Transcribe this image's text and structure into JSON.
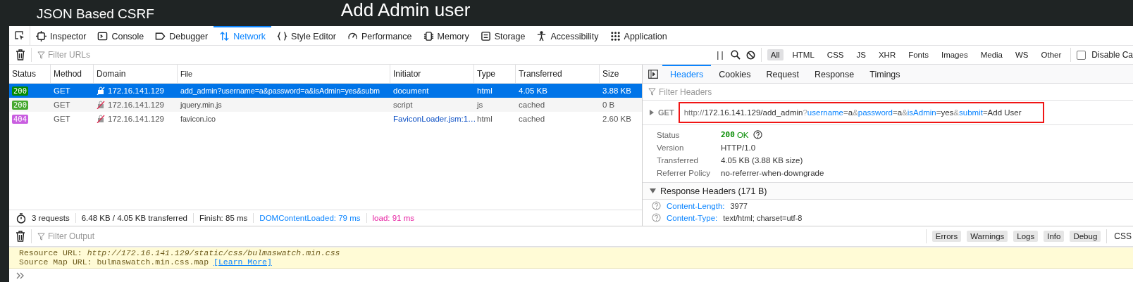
{
  "page": {
    "subtitle": "JSON Based CSRF",
    "heading": "Add Admin user"
  },
  "devtools_tabs": [
    {
      "label": "Inspector",
      "kind": "inspector",
      "selected": false
    },
    {
      "label": "Console",
      "kind": "console",
      "selected": false
    },
    {
      "label": "Debugger",
      "kind": "debugger",
      "selected": false
    },
    {
      "label": "Network",
      "kind": "network",
      "selected": true
    },
    {
      "label": "Style Editor",
      "kind": "style",
      "selected": false
    },
    {
      "label": "Performance",
      "kind": "performance",
      "selected": false
    },
    {
      "label": "Memory",
      "kind": "memory",
      "selected": false
    },
    {
      "label": "Storage",
      "kind": "storage",
      "selected": false
    },
    {
      "label": "Accessibility",
      "kind": "accessibility",
      "selected": false
    },
    {
      "label": "Application",
      "kind": "application",
      "selected": false
    }
  ],
  "toolbar": {
    "filter_placeholder": "Filter URLs",
    "pause_label": "| |",
    "type_filters": [
      {
        "label": "All",
        "selected": true
      },
      {
        "label": "HTML",
        "selected": false
      },
      {
        "label": "CSS",
        "selected": false
      },
      {
        "label": "JS",
        "selected": false
      },
      {
        "label": "XHR",
        "selected": false
      },
      {
        "label": "Fonts",
        "selected": false
      },
      {
        "label": "Images",
        "selected": false
      },
      {
        "label": "Media",
        "selected": false
      },
      {
        "label": "WS",
        "selected": false
      },
      {
        "label": "Other",
        "selected": false
      }
    ],
    "disable_cache": {
      "label": "Disable Ca",
      "checked": false
    }
  },
  "table": {
    "columns": [
      "Status",
      "Method",
      "Domain",
      "File",
      "Initiator",
      "Type",
      "Transferred",
      "Size"
    ],
    "rows": [
      {
        "status": "200",
        "color": "#058b00",
        "method": "GET",
        "domain": "172.16.141.129",
        "file": "add_admin?username=a&password=a&isAdmin=yes&subm",
        "initiator": "document",
        "initiator_link": false,
        "type": "html",
        "transferred": "4.05 KB",
        "size": "3.88 KB",
        "selected": true
      },
      {
        "status": "200",
        "color": "#45a82f",
        "method": "GET",
        "domain": "172.16.141.129",
        "file": "jquery.min.js",
        "initiator": "script",
        "initiator_link": false,
        "type": "js",
        "transferred": "cached",
        "size": "0 B",
        "selected": false
      },
      {
        "status": "404",
        "color": "#c95ee0",
        "method": "GET",
        "domain": "172.16.141.129",
        "file": "favicon.ico",
        "initiator": "FaviconLoader.jsm:1…",
        "initiator_link": true,
        "type": "html",
        "transferred": "cached",
        "size": "2.60 KB",
        "selected": false
      }
    ]
  },
  "summary": {
    "requests": "3 requests",
    "size": "6.48 KB / 4.05 KB transferred",
    "finish": "Finish: 85 ms",
    "dom_loaded": "DOMContentLoaded: 79 ms",
    "load": "load: 91 ms"
  },
  "details": {
    "tabs": [
      {
        "label": "Headers",
        "selected": true
      },
      {
        "label": "Cookies",
        "selected": false
      },
      {
        "label": "Request",
        "selected": false
      },
      {
        "label": "Response",
        "selected": false
      },
      {
        "label": "Timings",
        "selected": false
      }
    ],
    "filter_placeholder": "Filter Headers",
    "request": {
      "method": "GET",
      "highlighted": true,
      "url_parts": [
        {
          "text": "http://",
          "kind": "scheme"
        },
        {
          "text": "172.16.141.129/add_admin",
          "kind": "path"
        },
        {
          "text": "?",
          "kind": "sep"
        },
        {
          "text": "username",
          "kind": "key"
        },
        {
          "text": "=",
          "kind": "sep"
        },
        {
          "text": "a",
          "kind": "value"
        },
        {
          "text": "&",
          "kind": "sep"
        },
        {
          "text": "password",
          "kind": "key"
        },
        {
          "text": "=",
          "kind": "sep"
        },
        {
          "text": "a",
          "kind": "value"
        },
        {
          "text": "&",
          "kind": "sep"
        },
        {
          "text": "isAdmin",
          "kind": "key"
        },
        {
          "text": "=",
          "kind": "sep"
        },
        {
          "text": "yes",
          "kind": "value"
        },
        {
          "text": "&",
          "kind": "sep"
        },
        {
          "text": "submit",
          "kind": "key"
        },
        {
          "text": "=",
          "kind": "sep"
        },
        {
          "text": "Add User",
          "kind": "value"
        }
      ]
    },
    "status": {
      "label": "Status",
      "code": "200",
      "text": "OK"
    },
    "info": [
      {
        "label": "Version",
        "value": "HTTP/1.0"
      },
      {
        "label": "Transferred",
        "value": "4.05 KB (3.88 KB size)"
      },
      {
        "label": "Referrer Policy",
        "value": "no-referrer-when-downgrade"
      }
    ],
    "response_headers": {
      "title": "Response Headers (171 B)",
      "expanded": true,
      "items": [
        {
          "name": "Content-Length:",
          "value": "3977"
        },
        {
          "name": "Content-Type:",
          "value": "text/html; charset=utf-8"
        }
      ]
    }
  },
  "console": {
    "filter_placeholder": "Filter Output",
    "levels": [
      {
        "label": "Errors",
        "on": true
      },
      {
        "label": "Warnings",
        "on": true
      },
      {
        "label": "Logs",
        "on": true
      },
      {
        "label": "Info",
        "on": true
      },
      {
        "label": "Debug",
        "on": true
      }
    ],
    "css_label": "CSS",
    "message": {
      "resource_label": "Resource URL:",
      "resource_url": "http://172.16.141.129/static/css/bulmaswatch.min.css",
      "map_label": "Source Map URL:",
      "map_file": "bulmaswatch.min.css.map",
      "link": "[Learn More]"
    }
  }
}
